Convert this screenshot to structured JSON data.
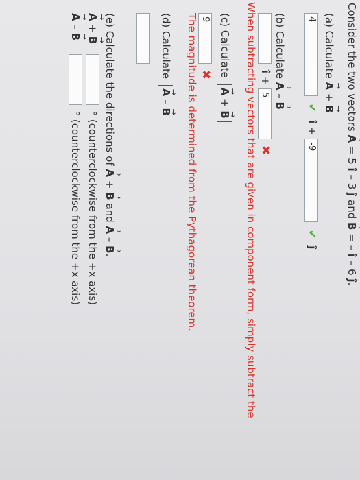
{
  "intro": {
    "prefix": "Consider the two vectors",
    "A_eq": "= 5",
    "A_mid": "– 3",
    "and": "and",
    "B_eq": "= –",
    "B_mid": "– 6",
    "end": "."
  },
  "part_a": {
    "label": "(a) Calculate",
    "plus": "+",
    "x_value": "4",
    "i_plus": "+",
    "y_value": "-9"
  },
  "part_b": {
    "label": "(b) Calculate",
    "minus": "–",
    "i_plus": "+",
    "x_value": "",
    "y_value": "5",
    "hint": "When subtracting vectors that are given in component form, simply subtract the"
  },
  "part_c": {
    "label": "(c) Calculate",
    "plus": "+",
    "value": "9",
    "hint": "The magnitude is determined from the Pythagorean theorem."
  },
  "part_d": {
    "label": "(d) Calculate",
    "minus": "–",
    "value": ""
  },
  "part_e": {
    "label": "(e) Calculate the directions of",
    "plus": "+",
    "and": "and",
    "minus": "–",
    "end": ".",
    "row1_value": "",
    "row1_unit": "° (counterclockwise from the +x axis)",
    "row2_value": "",
    "row2_unit": "° (counterclockwise from the +x axis)"
  },
  "symbols": {
    "A": "A",
    "B": "B",
    "i_hat": "î",
    "j_hat": "ĵ",
    "check": "✔",
    "cross": "✖"
  }
}
